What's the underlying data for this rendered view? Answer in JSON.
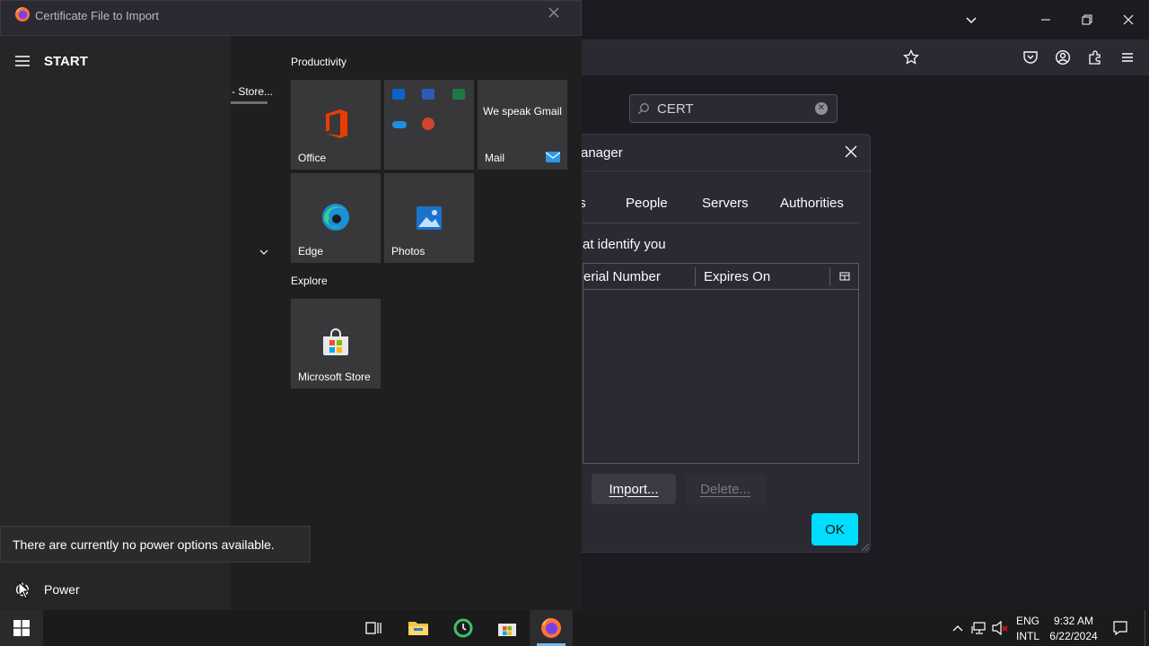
{
  "firefox": {
    "search": {
      "value": "CERT"
    }
  },
  "file_dialog": {
    "title": "Certificate File to Import"
  },
  "cert_manager": {
    "title_partial": "anager",
    "tabs": [
      "ıs",
      "People",
      "Servers",
      "Authorities"
    ],
    "description_partial": "at identify you",
    "columns": [
      "erial Number",
      "Expires On"
    ],
    "import_label": "Import...",
    "delete_label": "Delete...",
    "ok_label": "OK"
  },
  "start_menu": {
    "header": "START",
    "app_list_partial": "- Store...",
    "groups": {
      "productivity": "Productivity",
      "explore": "Explore"
    },
    "tiles": {
      "office": "Office",
      "mail_promo": "We speak Gmail",
      "mail": "Mail",
      "edge": "Edge",
      "photos": "Photos",
      "store": "Microsoft Store"
    },
    "power_tooltip": "There are currently no power options available.",
    "power_label": "Power"
  },
  "taskbar": {
    "lang_line1": "ENG",
    "lang_line2": "INTL",
    "time": "9:32 AM",
    "date": "6/22/2024"
  },
  "colors": {
    "accent": "#00ddff",
    "firefox_bg": "#1c1b22",
    "start_bg": "#262628"
  }
}
